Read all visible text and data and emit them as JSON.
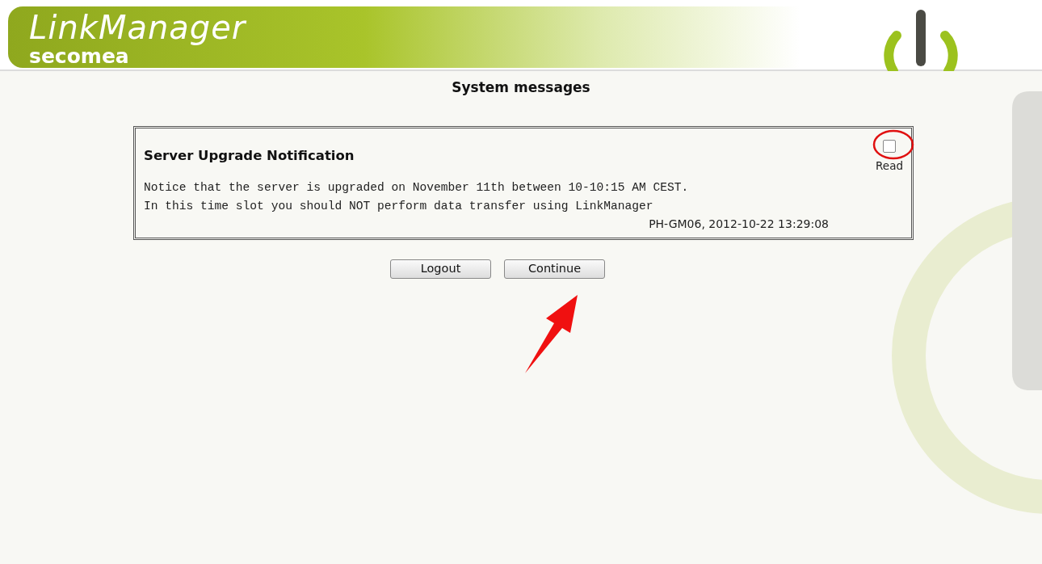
{
  "header": {
    "product": "LinkManager",
    "brand": "secomea"
  },
  "page_title": "System messages",
  "messages": [
    {
      "title": "Server Upgrade Notification",
      "read_label": "Read",
      "checked": false,
      "lines": [
        "Notice that the server is upgraded on November 11th between 10-10:15 AM CEST.",
        "In this time slot you should NOT perform data transfer using LinkManager"
      ],
      "footer": "PH-GM06, 2012-10-22 13:29:08"
    }
  ],
  "buttons": [
    {
      "label": "Logout"
    },
    {
      "label": "Continue"
    }
  ]
}
